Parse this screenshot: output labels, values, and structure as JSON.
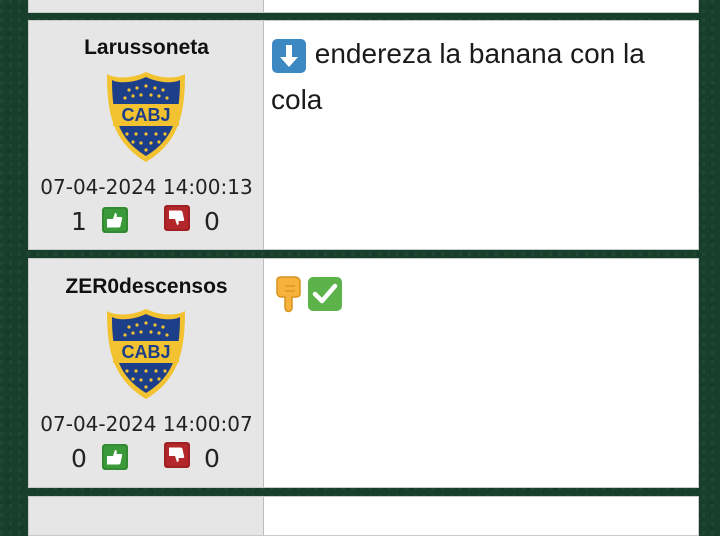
{
  "posts": [
    {
      "username": "Larussoneta",
      "timestamp": "07-04-2024 14:00:13",
      "likes": "1",
      "dislikes": "0",
      "message_text": "endereza la banana con la cola",
      "message_emojis": [
        "down-arrow-emoji"
      ]
    },
    {
      "username": "ZER0descensos",
      "timestamp": "07-04-2024 14:00:07",
      "likes": "0",
      "dislikes": "0",
      "message_text": "",
      "message_emojis": [
        "pointing-down-emoji",
        "check-mark-emoji"
      ]
    }
  ],
  "crest": {
    "text": "CABJ",
    "primary_color": "#1d3f8a",
    "band_color": "#f2c230"
  },
  "colors": {
    "background": "#183f2c",
    "like": "#3a9a3a",
    "dislike": "#b3262a"
  },
  "icons": {
    "like": "thumbs-up-icon",
    "dislike": "thumbs-down-icon"
  }
}
